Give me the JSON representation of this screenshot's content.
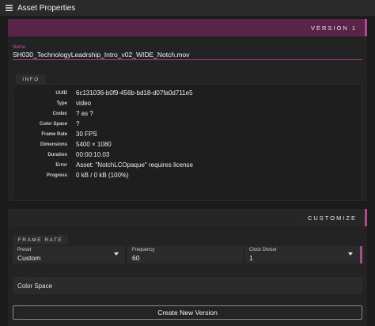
{
  "window": {
    "title": "Asset Properties",
    "menu_icon": "hamburger-menu-icon"
  },
  "version": {
    "label": "VERSION 1"
  },
  "name_field": {
    "label": "Name",
    "value": "SH030_TechnologyLeadrship_Intro_v02_WIDE_Notch.mov"
  },
  "info": {
    "section_label": "INFO",
    "rows": [
      {
        "key": "UUID",
        "value": "6c131036-b0f9-456b-bd18-d07fa0d711e5"
      },
      {
        "key": "Type",
        "value": "video"
      },
      {
        "key": "Codec",
        "value": "? as ?"
      },
      {
        "key": "Color Space",
        "value": "?"
      },
      {
        "key": "Frame Rate",
        "value": "30 FPS"
      },
      {
        "key": "Dimensions",
        "value": "5400 × 1080"
      },
      {
        "key": "Duration",
        "value": "00:00:10.03"
      },
      {
        "key": "Error",
        "value": "Asset: \"NotchLCOpaque\" requires license"
      },
      {
        "key": "Progress",
        "value": "0 kB / 0 kB (100%)"
      }
    ]
  },
  "customize": {
    "label": "CUSTOMIZE",
    "frame_rate_label": "FRAME RATE",
    "preset": {
      "label": "Preset",
      "value": "Custom"
    },
    "frequency": {
      "label": "Frequency",
      "value": "60"
    },
    "clock_divisor": {
      "label": "Clock Divisor",
      "value": "1"
    },
    "color_space": {
      "label": "Color Space"
    },
    "create_button": "Create New Version"
  },
  "colors": {
    "accent": "#c63b9a",
    "version_band": "#5a2448",
    "background": "#1b1b1b"
  }
}
